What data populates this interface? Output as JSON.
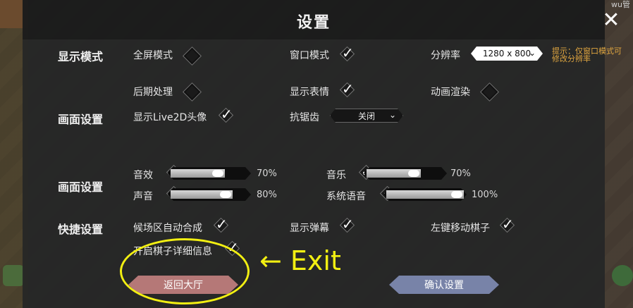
{
  "window": {
    "title": "设置",
    "corner_text": "wu管"
  },
  "display_mode": {
    "section_label": "显示模式",
    "fullscreen_label": "全屏模式",
    "fullscreen_checked": false,
    "window_label": "窗口模式",
    "window_checked": true,
    "resolution_label": "分辨率",
    "resolution_value": "1280 x 800",
    "hint": "提示：仅窗口模式可修改分辨率"
  },
  "graphics": {
    "section_label": "画面设置",
    "post_processing_label": "后期处理",
    "post_processing_checked": false,
    "show_expression_label": "显示表情",
    "show_expression_checked": true,
    "animation_render_label": "动画渲染",
    "animation_render_checked": false,
    "live2d_label": "显示Live2D头像",
    "live2d_checked": true,
    "antialias_label": "抗锯齿",
    "antialias_value": "关闭"
  },
  "audio": {
    "section_label": "画面设置",
    "sfx_label": "音效",
    "sfx_value": 70,
    "sfx_text": "70%",
    "music_label": "音乐",
    "music_value": 70,
    "music_text": "70%",
    "voice_label": "声音",
    "voice_value": 80,
    "voice_text": "80%",
    "system_voice_label": "系统语音",
    "system_voice_value": 100,
    "system_voice_text": "100%"
  },
  "shortcuts": {
    "section_label": "快捷设置",
    "auto_merge_label": "候场区自动合成",
    "auto_merge_checked": true,
    "show_barrage_label": "显示弹幕",
    "show_barrage_checked": true,
    "left_drag_label": "左键移动棋子",
    "left_drag_checked": true,
    "piece_details_label": "开启棋子详细信息",
    "piece_details_checked": true
  },
  "buttons": {
    "return_lobby": "返回大厅",
    "confirm": "确认设置"
  },
  "annotation": {
    "text": "← Exit",
    "color": "#f2ef12"
  },
  "colors": {
    "hint": "#e0a640",
    "return_button": "#b57877",
    "confirm_button": "#7883a8"
  }
}
